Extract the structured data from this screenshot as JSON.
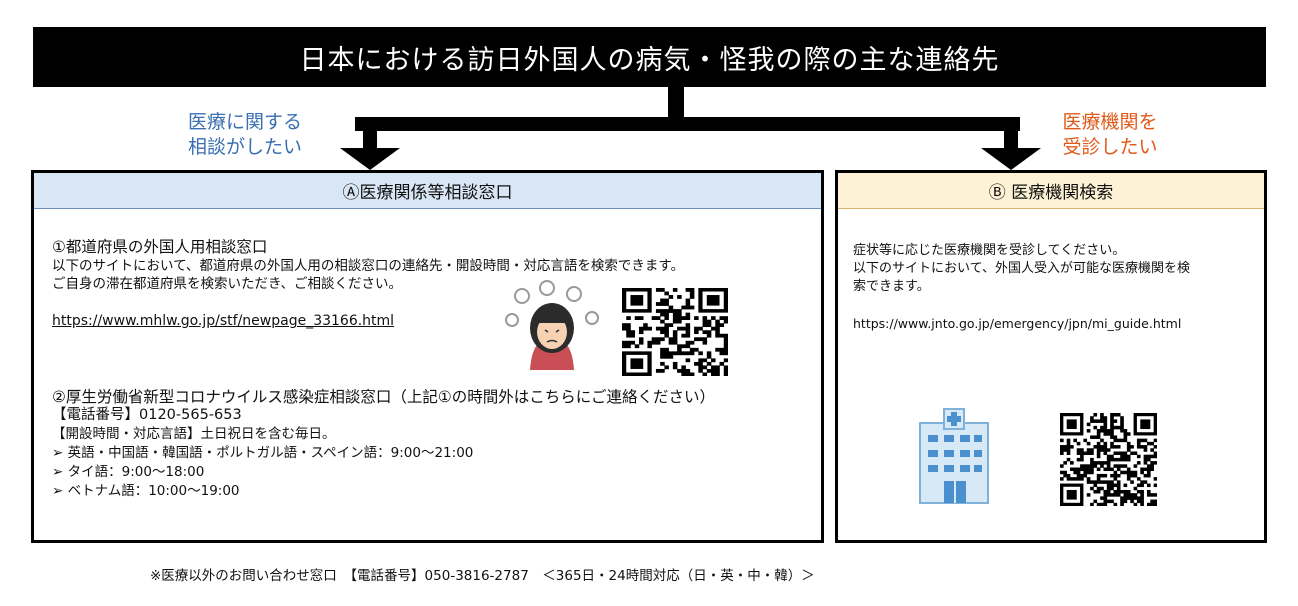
{
  "title": "日本における訪日外国人の病気・怪我の際の主な連絡先",
  "branches": {
    "left_label_1": "医療に関する",
    "left_label_2": "相談がしたい",
    "right_label_1": "医療機関を",
    "right_label_2": "受診したい"
  },
  "panel_a": {
    "heading": "Ⓐ医療関係等相談窓口",
    "section1_title": "①都道府県の外国人用相談窓口",
    "section1_line1": "以下のサイトにおいて、都道府県の外国人用の相談窓口の連絡先・開設時間・対応言語を検索できます。",
    "section1_line2": "ご自身の滞在都道府県を検索いただき、ご相談ください。",
    "section1_url": "https://www.mhlw.go.jp/stf/newpage_33166.html",
    "section2_title": "②厚生労働省新型コロナウイルス感染症相談窓口（上記①の時間外はこちらにご連絡ください）",
    "phone_line": "【電話番号】0120-565-653",
    "hours_line": "【開設時間・対応言語】土日祝日を含む毎日。",
    "lang_line1": "➢ 英語・中国語・韓国語・ポルトガル語・スペイン語：9:00～21:00",
    "lang_line2": "➢ タイ語：9:00～18:00",
    "lang_line3": "➢ ベトナム語：10:00～19:00"
  },
  "panel_b": {
    "heading": "Ⓑ 医療機関検索",
    "line1": "症状等に応じた医療機関を受診してください。",
    "line2": "以下のサイトにおいて、外国人受入が可能な医療機関を検",
    "line3": "索できます。",
    "url": "https://www.jnto.go.jp/emergency/jpn/mi_guide.html"
  },
  "footer": "※医療以外のお問い合わせ窓口　【電話番号】050-3816-2787　＜365日・24時間対応（日・英・中・韓）＞",
  "colors": {
    "left_label": "#3a6fb0",
    "right_label": "#e05a1a",
    "panel_a_header": "#d9e6f5",
    "panel_b_header": "#fdf2d5"
  }
}
